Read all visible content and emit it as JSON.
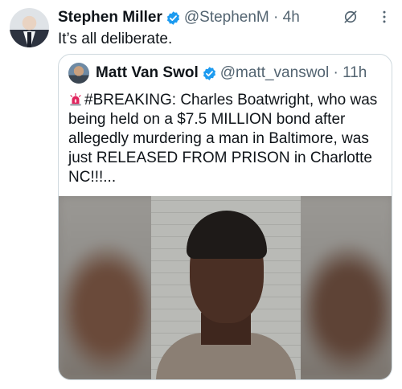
{
  "tweet": {
    "author_name": "Stephen Miller",
    "handle_time": "@StephenM · 4h",
    "text": "It’s all deliberate."
  },
  "quoted_tweet": {
    "author_name": "Matt Van Swol",
    "handle_time": "@matt_vanswol · 11h",
    "text": "#BREAKING: Charles Boatwright, who was being held on a $7.5 MILLION bond after allegedly murdering a man in Baltimore, was just RELEASED FROM PRISON in Charlotte NC!!!...",
    "leading_emoji": "siren-icon"
  },
  "colors": {
    "verified_blue": "#1d9bf0",
    "text_primary": "#0f1419",
    "text_secondary": "#536471",
    "border": "#cfd9de"
  },
  "icons": [
    "verified-badge-icon",
    "grok-icon",
    "more-options-icon",
    "siren-icon"
  ]
}
